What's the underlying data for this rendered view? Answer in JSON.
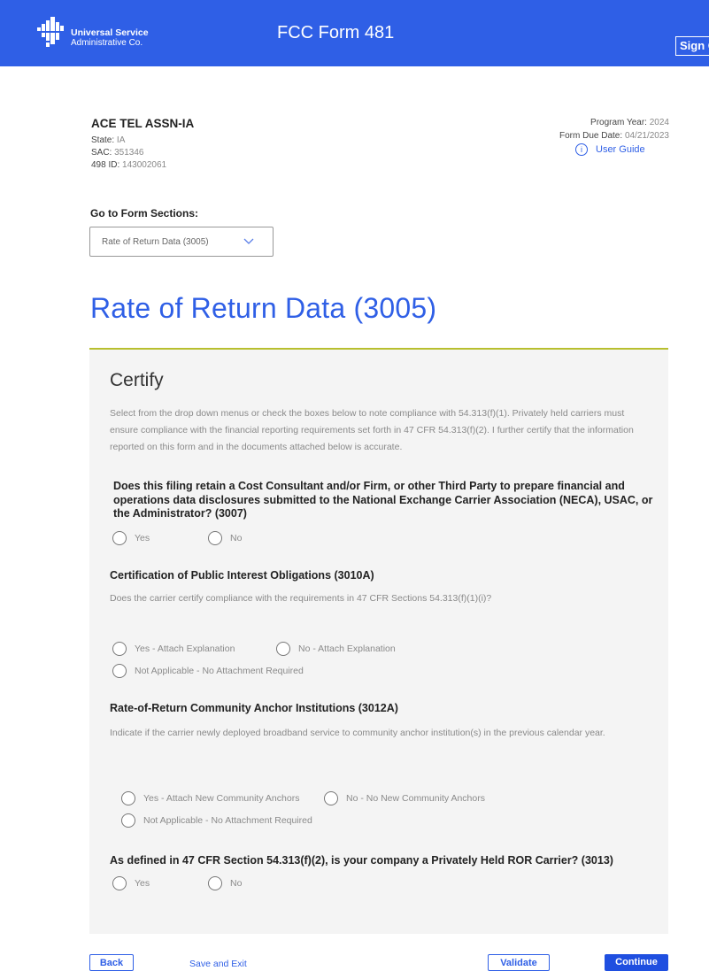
{
  "header": {
    "logo_line1": "Universal Service",
    "logo_line2": "Administrative Co.",
    "app_title": "FCC Form 481",
    "signout_label": "Sign Out"
  },
  "company": {
    "name": "ACE TEL ASSN-IA",
    "state_label": "State:",
    "state": "IA",
    "sac_label": "SAC:",
    "sac": "351346",
    "id498_label": "498 ID:",
    "id498": "143002061"
  },
  "program": {
    "year_label": "Program Year:",
    "year": "2024",
    "due_label": "Form Due Date:",
    "due": "04/21/2023",
    "user_guide": "User Guide"
  },
  "sections": {
    "label": "Go to Form Sections:",
    "selected": "Rate of Return Data (3005)"
  },
  "page_title": "Rate of Return Data (3005)",
  "certify": {
    "heading": "Certify",
    "intro": "Select from the drop down menus or check the boxes below to note compliance with 54.313(f)(1). Privately held carriers must ensure compliance with the financial reporting requirements set forth in 47 CFR 54.313(f)(2). I further certify that the information reported on this form and in the documents attached below is accurate.",
    "q3007": {
      "text": "Does this filing retain a Cost Consultant and/or Firm, or other Third Party to prepare financial and operations data disclosures submitted to the National Exchange Carrier Association (NECA), USAC, or the Administrator? (3007)",
      "opt_yes": "Yes",
      "opt_no": "No"
    },
    "q3010a": {
      "title": "Certification of Public Interest Obligations (3010A)",
      "desc": "Does the carrier certify compliance with the requirements in 47 CFR Sections 54.313(f)(1)(i)?",
      "opt1": "Yes - Attach Explanation",
      "opt2": "No - Attach Explanation",
      "opt3": "Not Applicable - No Attachment Required"
    },
    "q3012a": {
      "title": "Rate-of-Return Community Anchor Institutions (3012A)",
      "desc": "Indicate if the carrier newly deployed broadband service to community anchor institution(s) in the previous calendar year.",
      "opt1": "Yes - Attach New Community Anchors",
      "opt2": "No - No New Community Anchors",
      "opt3": "Not Applicable - No Attachment Required"
    },
    "q3013": {
      "text": "As defined in 47 CFR Section 54.313(f)(2), is your company a Privately Held ROR Carrier? (3013)",
      "opt_yes": "Yes",
      "opt_no": "No"
    }
  },
  "footer": {
    "back": "Back",
    "save_exit": "Save and Exit",
    "validate": "Validate",
    "continue": "Continue"
  },
  "colors": {
    "brand_blue": "#2f5fe6",
    "accent_olive": "#b8bf2e",
    "panel_bg": "#f4f4f4"
  }
}
